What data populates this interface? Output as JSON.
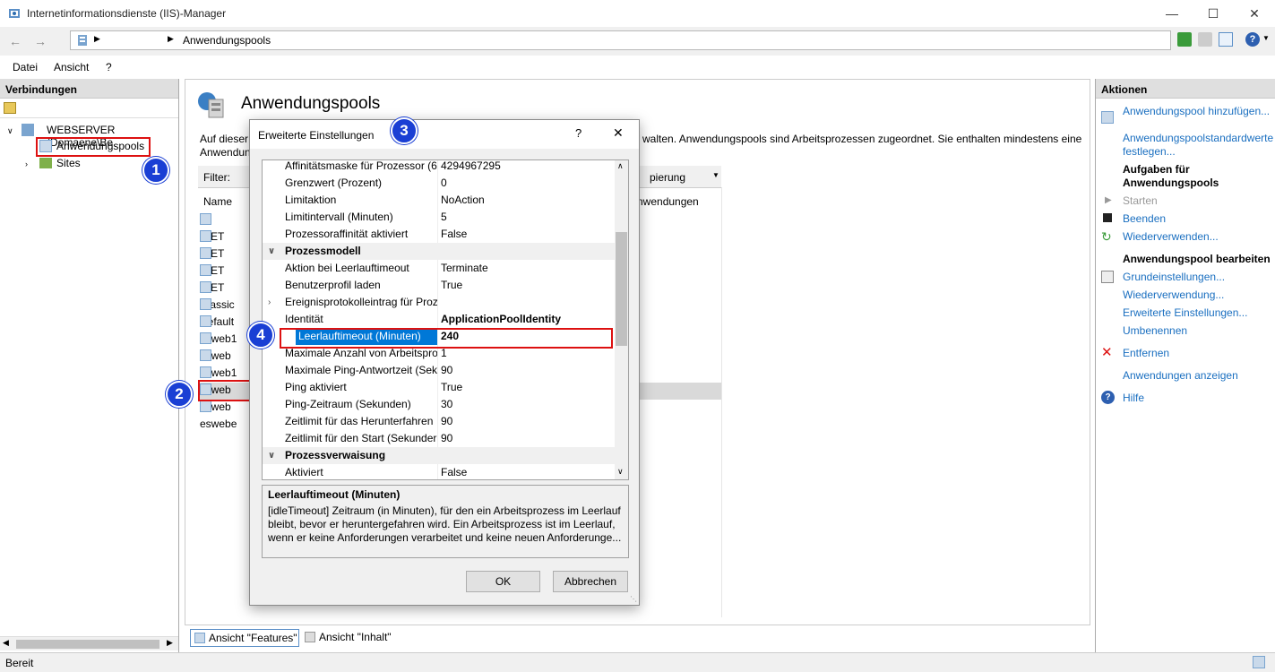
{
  "window": {
    "title": "Internetinformationsdienste (IIS)-Manager"
  },
  "address": {
    "path": "Anwendungspools"
  },
  "menu": [
    "Datei",
    "Ansicht",
    "?"
  ],
  "connections": {
    "header": "Verbindungen",
    "server": "WEBSERVER (Domaene\\Be",
    "app_pools": "Anwendungspools",
    "sites": "Sites"
  },
  "center": {
    "title": "Anwendungspools",
    "desc1": "Auf dieser",
    "desc1_right": "walten. Anwendungspools sind Arbeitsprozessen zugeordnet. Sie enthalten mindestens eine",
    "desc2": "Anwendun",
    "filter_label": "Filter:",
    "group_label": "pierung",
    "col_name": "Name",
    "col_apps": "nwendungen",
    "pools": [
      ".NET v2",
      ".NET v2",
      ".NET v4",
      ".NET v4",
      "Classic",
      "Default",
      "esweb1",
      "esweb",
      "esweb1",
      "esweb",
      "esweb",
      "eswebe"
    ],
    "view_features": "Ansicht \"Features\"",
    "view_content": "Ansicht \"Inhalt\""
  },
  "dialog": {
    "title": "Erweiterte Einstellungen",
    "help": "?",
    "rows": [
      {
        "key": "Affinitätsmaske für Prozessor (64",
        "value": "4294967295",
        "type": "prop"
      },
      {
        "key": "Grenzwert (Prozent)",
        "value": "0",
        "type": "prop"
      },
      {
        "key": "Limitaktion",
        "value": "NoAction",
        "type": "prop"
      },
      {
        "key": "Limitintervall (Minuten)",
        "value": "5",
        "type": "prop"
      },
      {
        "key": "Prozessoraffinität aktiviert",
        "value": "False",
        "type": "prop"
      },
      {
        "key": "Prozessmodell",
        "value": "",
        "type": "cat"
      },
      {
        "key": "Aktion bei Leerlauftimeout",
        "value": "Terminate",
        "type": "prop"
      },
      {
        "key": "Benutzerprofil laden",
        "value": "True",
        "type": "prop"
      },
      {
        "key": "Ereignisprotokolleintrag für Proz",
        "value": "",
        "type": "expand"
      },
      {
        "key": "Identität",
        "value": "ApplicationPoolIdentity",
        "type": "bold"
      },
      {
        "key": "Leerlauftimeout (Minuten)",
        "value": "240",
        "type": "selected"
      },
      {
        "key": "Maximale Anzahl von Arbeitspro",
        "value": "1",
        "type": "prop"
      },
      {
        "key": "Maximale Ping-Antwortzeit (Sek",
        "value": "90",
        "type": "prop"
      },
      {
        "key": "Ping aktiviert",
        "value": "True",
        "type": "prop"
      },
      {
        "key": "Ping-Zeitraum (Sekunden)",
        "value": "30",
        "type": "prop"
      },
      {
        "key": "Zeitlimit für das Herunterfahren",
        "value": "90",
        "type": "prop"
      },
      {
        "key": "Zeitlimit für den Start (Sekunder",
        "value": "90",
        "type": "prop"
      },
      {
        "key": "Prozessverwaisung",
        "value": "",
        "type": "cat"
      },
      {
        "key": "Aktiviert",
        "value": "False",
        "type": "prop"
      }
    ],
    "desc_title": "Leerlauftimeout (Minuten)",
    "desc_text": "[idleTimeout] Zeitraum (in Minuten), für den ein Arbeitsprozess im Leerlauf bleibt, bevor er heruntergefahren wird. Ein Arbeitsprozess ist im Leerlauf, wenn er keine Anforderungen verarbeitet und keine neuen Anforderunge...",
    "ok": "OK",
    "cancel": "Abbrechen"
  },
  "actions": {
    "header": "Aktionen",
    "add": "Anwendungspool hinzufügen...",
    "defaults": "Anwendungspoolstandardwerte festlegen...",
    "tasks_head": "Aufgaben für Anwendungspools",
    "start": "Starten",
    "stop": "Beenden",
    "recycle": "Wiederverwenden...",
    "edit_head": "Anwendungspool bearbeiten",
    "basic": "Grundeinstellungen...",
    "recycling": "Wiederverwendung...",
    "advanced": "Erweiterte Einstellungen...",
    "rename": "Umbenennen",
    "remove": "Entfernen",
    "view_apps": "Anwendungen anzeigen",
    "help": "Hilfe"
  },
  "status": {
    "text": "Bereit"
  },
  "badges": [
    "1",
    "2",
    "3",
    "4"
  ],
  "colors": {
    "accent": "#1a6fc0",
    "selection": "#0078d7",
    "badge": "#1a3fd4",
    "highlight_border": "#d11111"
  }
}
